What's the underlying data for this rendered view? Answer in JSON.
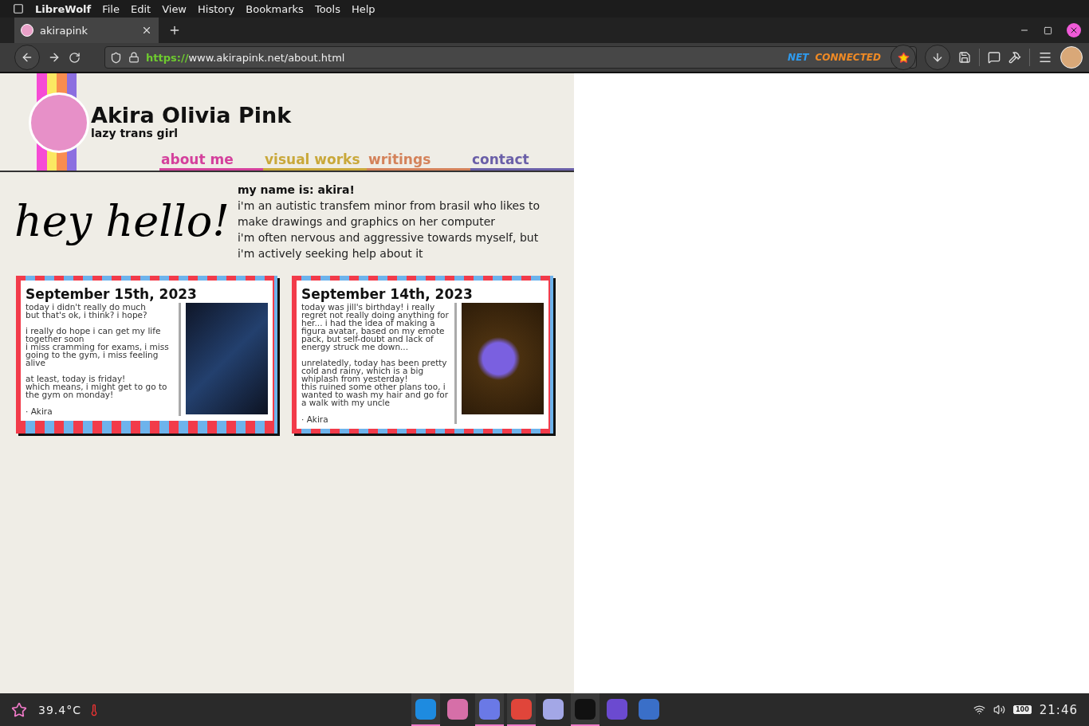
{
  "menu_bar": {
    "app_name": "LibreWolf",
    "items": [
      "File",
      "Edit",
      "View",
      "History",
      "Bookmarks",
      "Tools",
      "Help"
    ]
  },
  "tabs": [
    {
      "label": "akirapink",
      "selected": true
    }
  ],
  "address_bar": {
    "scheme": "https://",
    "address": "www.akirapink.net/about.html"
  },
  "extension_badge": {
    "part_1": "NET",
    "part_2": "CONNECTED"
  },
  "site": {
    "name": "Akira Olivia Pink",
    "tagline": "lazy trans girl",
    "nav": [
      {
        "label": "about me",
        "color": "#d4409c"
      },
      {
        "label": "visual works",
        "color": "#c9a83a"
      },
      {
        "label": "writings",
        "color": "#d4825a"
      },
      {
        "label": "contact",
        "color": "#6a5fa8"
      }
    ],
    "greeting": "hey hello!",
    "intro": {
      "heading": "my name is: akira!",
      "lines": [
        "i'm an autistic transfem minor from brasil who likes to make drawings and graphics on her computer",
        "i'm often nervous and aggressive towards myself, but i'm actively seeking help about it"
      ]
    },
    "posts": [
      {
        "date": "September 15th, 2023",
        "kind": "abstract",
        "paragraphs": [
          "today i didn't really do much\nbut that's ok, i think? i hope?",
          "i really do hope i can get my life together soon\ni miss cramming for exams, i miss going to the gym, i miss feeling alive",
          "at least, today is friday!\nwhich means, i might get to go to the gym on monday!"
        ],
        "signature": "· Akira"
      },
      {
        "date": "September 14th, 2023",
        "kind": "flower",
        "paragraphs": [
          "today was jill's birthday! i really regret not really doing anything for her... i had the idea of making a figura avatar, based on my emote pack, but self-doubt and lack of energy struck me down...",
          "unrelatedly, today has been pretty cold and rainy, which is a big whiplash from yesterday!\nthis ruined some other plans too, i wanted to wash my hair and go for a walk with my uncle"
        ],
        "signature": "· Akira"
      }
    ]
  },
  "taskbar": {
    "temperature": "39.4°C",
    "apps": [
      {
        "kind": "browser",
        "active": true
      },
      {
        "kind": "folder",
        "active": false
      },
      {
        "kind": "chat",
        "active": true
      },
      {
        "kind": "paint",
        "active": true
      },
      {
        "kind": "notes",
        "active": false
      },
      {
        "kind": "terminal",
        "active": true
      },
      {
        "kind": "crystal",
        "active": false
      },
      {
        "kind": "camera",
        "active": false
      }
    ],
    "battery": "100",
    "clock": "21:46"
  }
}
